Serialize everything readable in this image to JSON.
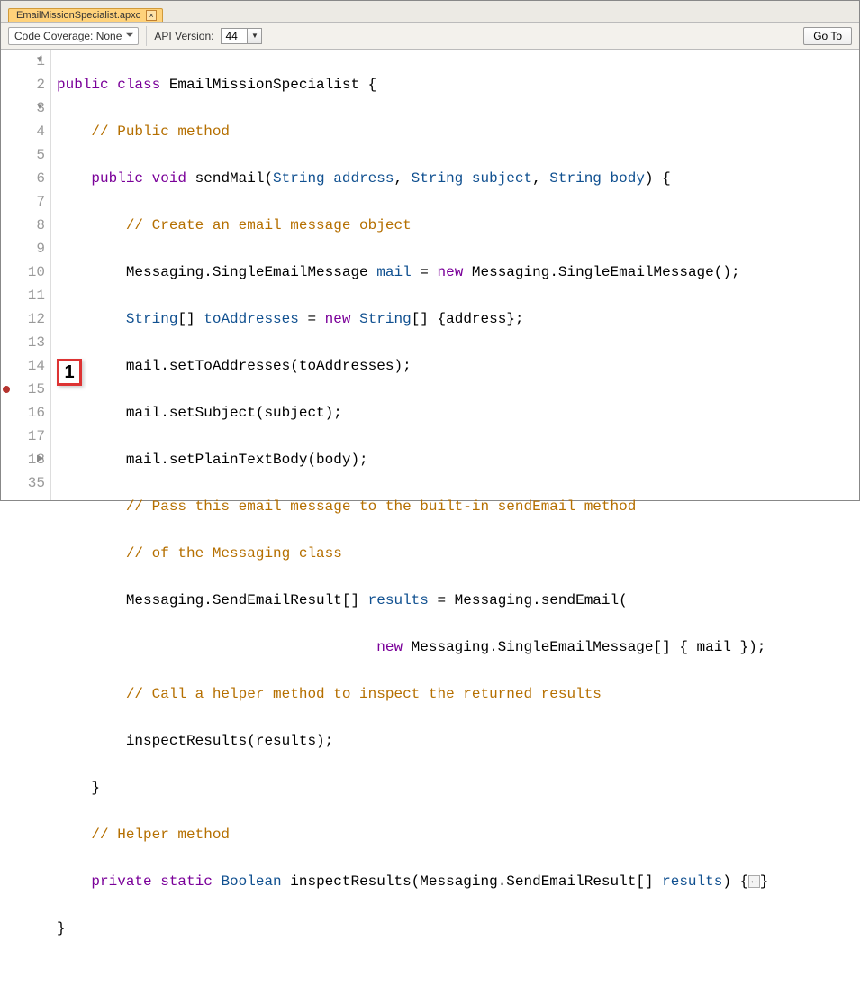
{
  "tab": {
    "title": "EmailMissionSpecialist.apxc",
    "close": "×"
  },
  "toolbar": {
    "coverage": "Code Coverage: None",
    "apiLabel": "API Version:",
    "apiValue": "44",
    "goto": "Go To"
  },
  "callout": "1",
  "gutter": [
    "1",
    "2",
    "3",
    "4",
    "5",
    "6",
    "7",
    "8",
    "9",
    "10",
    "11",
    "12",
    "13",
    "14",
    "15",
    "16",
    "17",
    "18",
    "35"
  ],
  "code": {
    "l1a": "public",
    "l1b": " class",
    "l1c": " EmailMissionSpecialist {",
    "l2": "    // Public method",
    "l3a": "    public",
    "l3b": " void",
    "l3c": " sendMail(",
    "l3d": "String",
    "l3e": " address",
    "l3f": ", ",
    "l3g": "String",
    "l3h": " subject",
    "l3i": ", ",
    "l3j": "String",
    "l3k": " body",
    "l3l": ") {",
    "l4": "        // Create an email message object",
    "l5a": "        Messaging.SingleEmailMessage ",
    "l5b": "mail",
    "l5c": " = ",
    "l5d": "new",
    "l5e": " Messaging.SingleEmailMessage();",
    "l6a": "        String",
    "l6b": "[] ",
    "l6c": "toAddresses",
    "l6d": " = ",
    "l6e": "new",
    "l6f": " String",
    "l6g": "[] {address};",
    "l7": "        mail.setToAddresses(toAddresses);",
    "l8": "        mail.setSubject(subject);",
    "l9": "        mail.setPlainTextBody(body);",
    "l10": "        // Pass this email message to the built-in sendEmail method",
    "l11": "        // of the Messaging class",
    "l12a": "        Messaging.SendEmailResult[] ",
    "l12b": "results",
    "l12c": " = Messaging.sendEmail(",
    "l13a": "                                     new",
    "l13b": " Messaging.SingleEmailMessage[] { mail });",
    "l14": "        // Call a helper method to inspect the returned results",
    "l15": "        inspectResults(results);",
    "l16": "    }",
    "l17": "    // Helper method",
    "l18a": "    private",
    "l18b": " static",
    "l18c": " Boolean",
    "l18d": " inspectResults(Messaging.SendEmailResult[] ",
    "l18e": "results",
    "l18f": ") {",
    "l18g": "↔",
    "l18h": "}",
    "l35": "}"
  }
}
